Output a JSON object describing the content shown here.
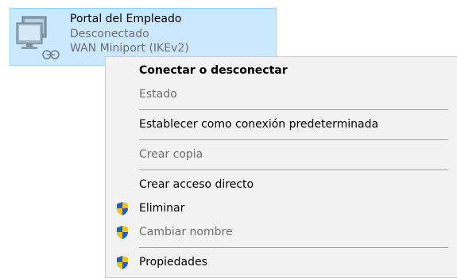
{
  "connection": {
    "name": "Portal del Empleado",
    "status": "Desconectado",
    "device": "WAN Miniport (IKEv2)",
    "icon": "vpn-connection-icon"
  },
  "context_menu": {
    "connect": "Conectar o desconectar",
    "status": "Estado",
    "set_default": "Establecer como conexión predeterminada",
    "create_copy": "Crear copia",
    "create_shortcut": "Crear acceso directo",
    "delete": "Eliminar",
    "rename": "Cambiar nombre",
    "properties": "Propiedades",
    "shield_icon": "uac-shield-icon"
  },
  "colors": {
    "selection_bg": "#cce8ff",
    "selection_border": "#99d1ff",
    "menu_bg": "#f2f2f2",
    "disabled_text": "#6d6d6d",
    "shield_blue": "#1f5fc0",
    "shield_yellow": "#f5c400"
  }
}
